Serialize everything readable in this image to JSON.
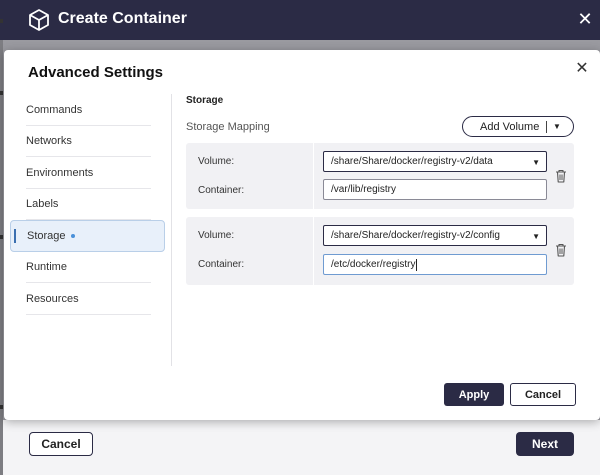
{
  "window": {
    "title": "Create Container",
    "icon": "cube-icon",
    "close_glyph": "✕",
    "footer": {
      "cancel_label": "Cancel",
      "next_label": "Next"
    }
  },
  "modal": {
    "title": "Advanced Settings",
    "close_glyph": "✕",
    "sidebar": {
      "items": [
        {
          "label": "Commands",
          "active": false
        },
        {
          "label": "Networks",
          "active": false
        },
        {
          "label": "Environments",
          "active": false
        },
        {
          "label": "Labels",
          "active": false
        },
        {
          "label": "Storage",
          "active": true
        },
        {
          "label": "Runtime",
          "active": false
        },
        {
          "label": "Resources",
          "active": false
        }
      ]
    },
    "storage": {
      "section_title": "Storage",
      "mapping_label": "Storage Mapping",
      "add_volume_label": "Add Volume",
      "volume_label": "Volume:",
      "container_label": "Container:",
      "mappings": [
        {
          "volume": "/share/Share/docker/registry-v2/data",
          "container": "/var/lib/registry"
        },
        {
          "volume": "/share/Share/docker/registry-v2/config",
          "container": "/etc/docker/registry"
        }
      ]
    },
    "footer": {
      "apply_label": "Apply",
      "cancel_label": "Cancel"
    }
  },
  "colors": {
    "titlebar": "#2b2b45",
    "primary_button": "#2b2b45",
    "active_item_bg": "#e8f0fa",
    "active_dot": "#4a90d9",
    "card_bg": "#f1f1f4"
  }
}
